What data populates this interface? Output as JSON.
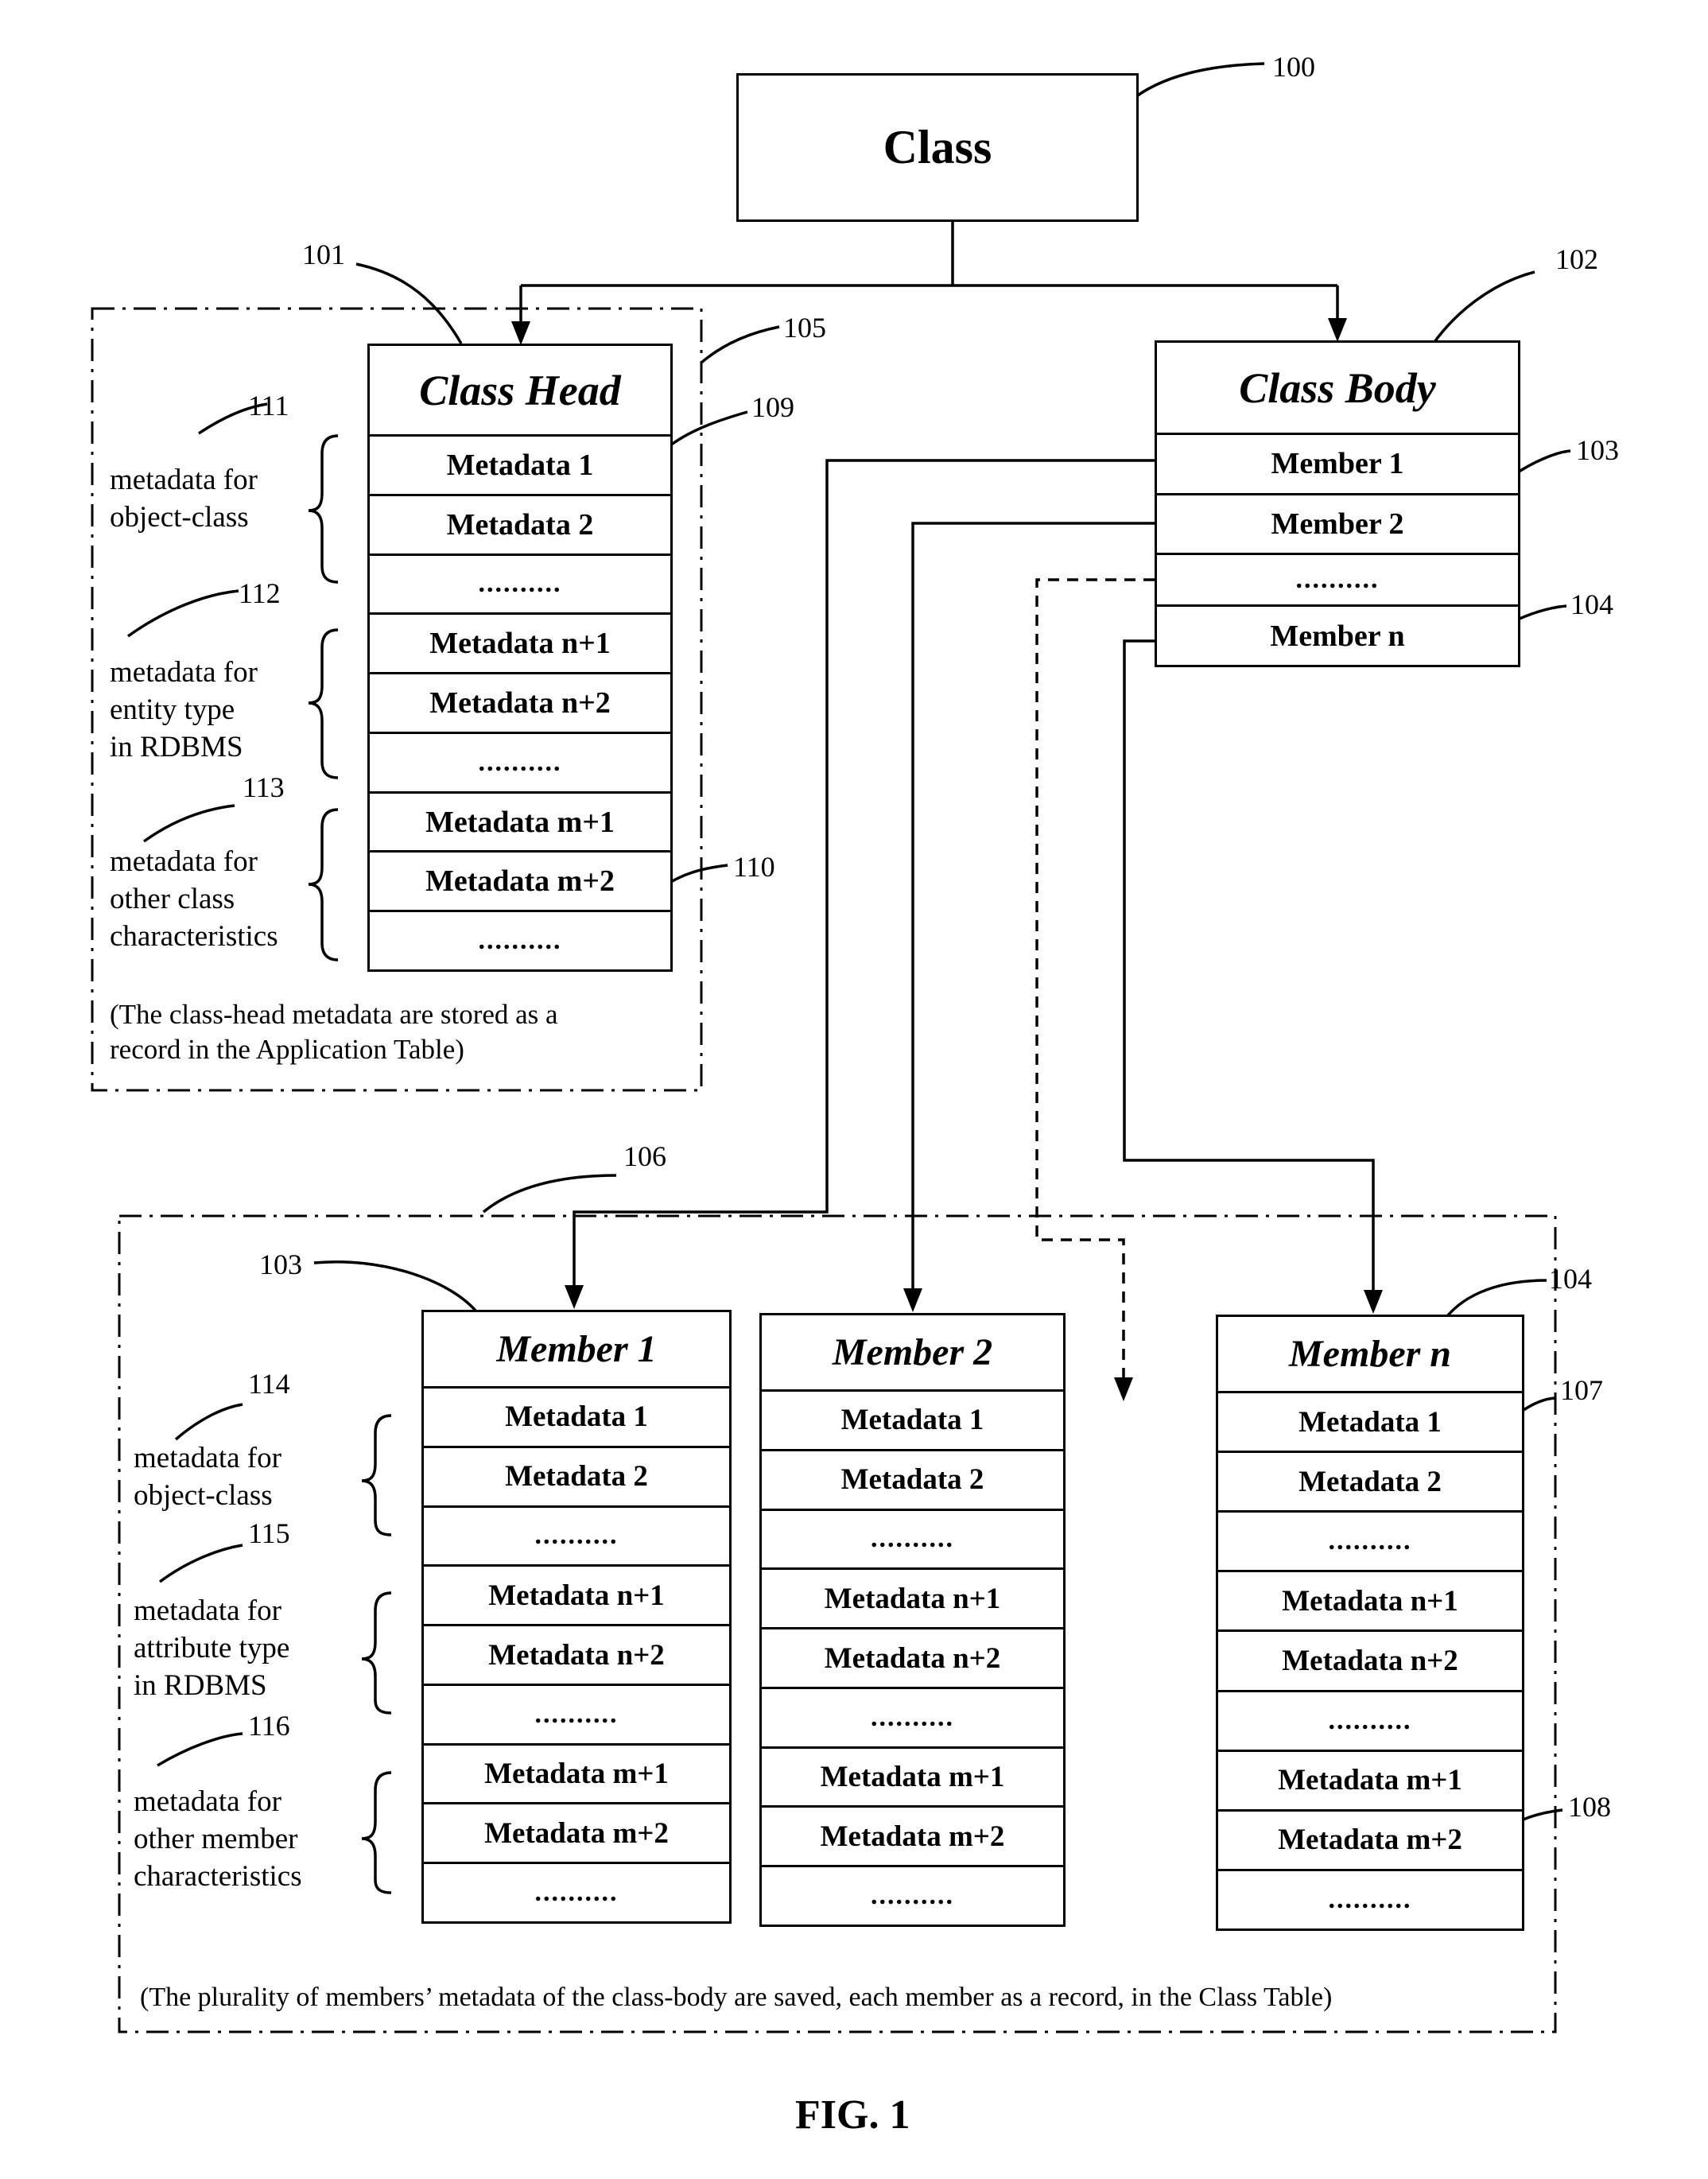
{
  "figure_label": "FIG. 1",
  "class_box": {
    "title": "Class",
    "ref": "100"
  },
  "class_head": {
    "title": "Class Head",
    "ref": "101",
    "group_ref": "105",
    "rows": [
      "Metadata 1",
      "Metadata 2",
      "..........",
      "Metadata n+1",
      "Metadata n+2",
      "..........",
      "Metadata m+1",
      "Metadata m+2",
      ".........."
    ],
    "row_refs": {
      "first_row": "109",
      "m_plus_2": "110"
    },
    "groups": [
      {
        "ref": "111",
        "lines": [
          "metadata for",
          "object-class"
        ]
      },
      {
        "ref": "112",
        "lines": [
          "metadata for",
          "entity type",
          "in RDBMS"
        ]
      },
      {
        "ref": "113",
        "lines": [
          "metadata for",
          "other class",
          "characteristics"
        ]
      }
    ],
    "caption": [
      "(The class-head metadata are stored as a",
      "record in the Application Table)"
    ]
  },
  "class_body": {
    "title": "Class Body",
    "ref": "102",
    "rows": [
      "Member 1",
      "Member 2",
      "..........",
      "Member n"
    ],
    "row_refs": {
      "member_1": "103",
      "member_n": "104"
    }
  },
  "members_group": {
    "ref": "106",
    "groups": [
      {
        "ref": "114",
        "lines": [
          "metadata for",
          "object-class"
        ]
      },
      {
        "ref": "115",
        "lines": [
          "metadata for",
          "attribute type",
          "in RDBMS"
        ]
      },
      {
        "ref": "116",
        "lines": [
          "metadata for",
          "other member",
          "characteristics"
        ]
      }
    ],
    "members": [
      {
        "title": "Member 1",
        "ref": "103",
        "rows": [
          "Metadata 1",
          "Metadata 2",
          "..........",
          "Metadata n+1",
          "Metadata n+2",
          "..........",
          "Metadata m+1",
          "Metadata m+2",
          ".........."
        ]
      },
      {
        "title": "Member 2",
        "rows": [
          "Metadata 1",
          "Metadata 2",
          "..........",
          "Metadata n+1",
          "Metadata n+2",
          "..........",
          "Metadata m+1",
          "Metadata m+2",
          ".........."
        ]
      },
      {
        "title": "Member n",
        "ref": "104",
        "rows": [
          "Metadata 1",
          "Metadata 2",
          "..........",
          "Metadata n+1",
          "Metadata n+2",
          "..........",
          "Metadata m+1",
          "Metadata m+2",
          ".........."
        ]
      }
    ],
    "row_refs": {
      "member_n_first_row": "107",
      "member_n_m_plus_2": "108"
    },
    "caption": "(The plurality of members’ metadata of the class-body are saved, each member as a record, in the Class Table)"
  }
}
